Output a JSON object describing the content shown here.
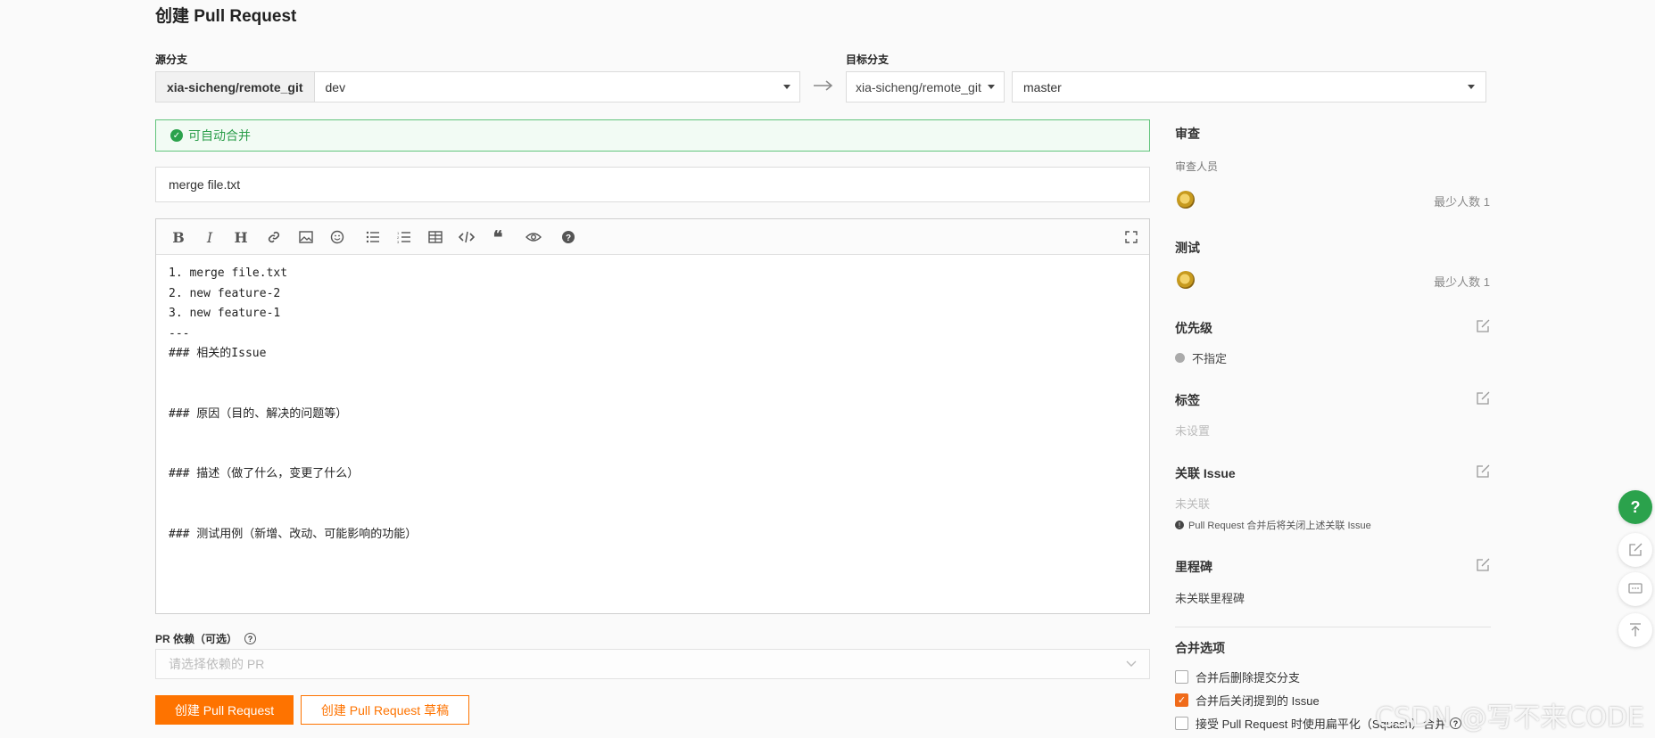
{
  "page": {
    "title": "创建 Pull Request"
  },
  "source": {
    "label": "源分支",
    "repo": "xia-sicheng/remote_git",
    "branch": "dev"
  },
  "target": {
    "label": "目标分支",
    "repo": "xia-sicheng/remote_git",
    "branch": "master"
  },
  "merge_status": {
    "text": "可自动合并",
    "color": "#2ba24c"
  },
  "pr_title": {
    "value": "merge file.txt"
  },
  "editor": {
    "toolbar": [
      "bold-icon",
      "italic-icon",
      "heading-icon",
      "link-icon",
      "image-icon",
      "emoji-icon",
      "unordered-list-icon",
      "ordered-list-icon",
      "table-icon",
      "code-icon",
      "quote-icon",
      "preview-icon",
      "help-icon",
      "fullscreen-icon"
    ],
    "lines": [
      "1. merge file.txt",
      "2. new feature-2",
      "3. new feature-1",
      "---",
      "### 相关的Issue",
      "",
      "",
      "### 原因（目的、解决的问题等）",
      "",
      "",
      "### 描述（做了什么，变更了什么）",
      "",
      "",
      "### 测试用例（新增、改动、可能影响的功能）"
    ]
  },
  "dependency": {
    "label": "PR 依赖（可选）",
    "placeholder": "请选择依赖的 PR"
  },
  "buttons": {
    "create": "创建 Pull Request",
    "draft": "创建 Pull Request 草稿"
  },
  "sidebar": {
    "review": {
      "title": "审查",
      "sub": "审查人员",
      "min": "最少人数 1"
    },
    "test": {
      "title": "测试",
      "min": "最少人数 1"
    },
    "priority": {
      "title": "优先级",
      "value": "不指定"
    },
    "labels": {
      "title": "标签",
      "value": "未设置"
    },
    "issue": {
      "title": "关联 Issue",
      "value": "未关联",
      "note": "Pull Request 合并后将关闭上述关联 Issue"
    },
    "milestone": {
      "title": "里程碑",
      "value": "未关联里程碑"
    },
    "merge_options": {
      "title": "合并选项",
      "items": [
        {
          "label": "合并后删除提交分支",
          "checked": false
        },
        {
          "label": "合并后关闭提到的 Issue",
          "checked": true
        },
        {
          "label": "接受 Pull Request 时使用扁平化（Squash）合并",
          "checked": false
        }
      ]
    }
  },
  "floating": {
    "help": "?"
  },
  "watermark": "CSDN @写不来CODE",
  "colors": {
    "accent": "#fe7300",
    "success": "#2ba24c",
    "help_button": "#2ba24c"
  }
}
